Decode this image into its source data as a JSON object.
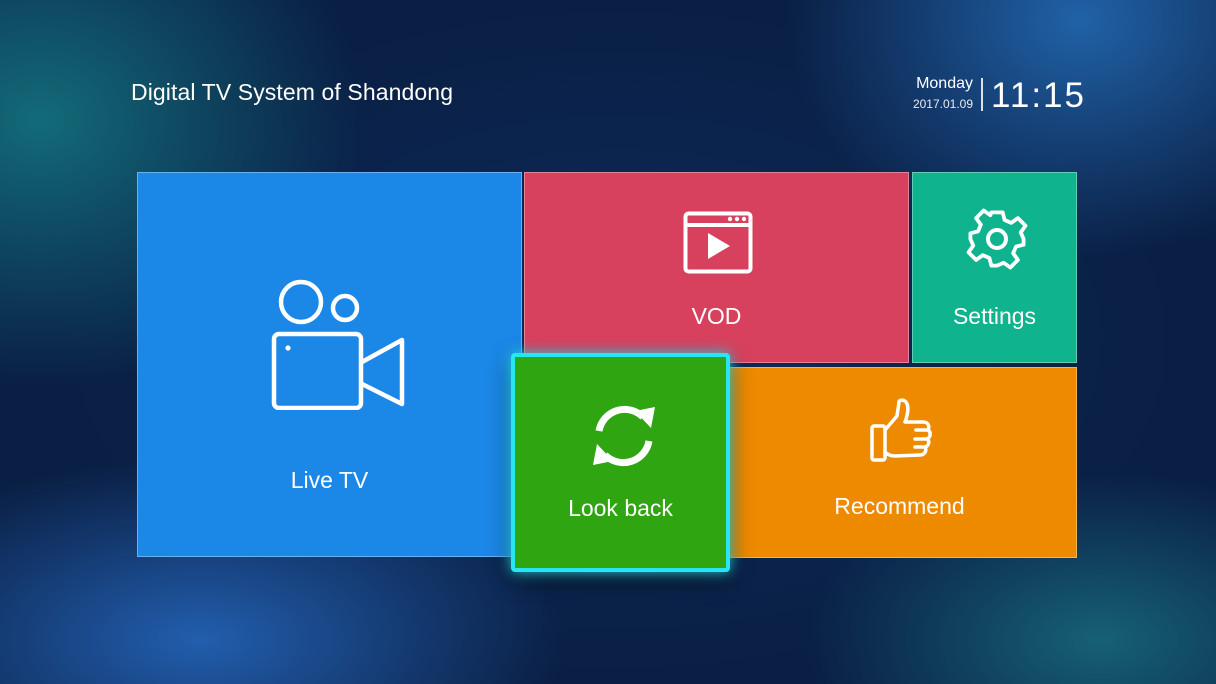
{
  "header": {
    "title": "Digital TV System of Shandong",
    "weekday": "Monday",
    "date": "2017.01.09",
    "time": "11:15"
  },
  "tiles": [
    {
      "id": "live-tv",
      "label": "Live TV",
      "icon": "video-camera-icon",
      "color": "#1b87e6"
    },
    {
      "id": "vod",
      "label": "VOD",
      "icon": "video-play-icon",
      "color": "#d8415e"
    },
    {
      "id": "settings",
      "label": "Settings",
      "icon": "gear-icon",
      "color": "#0fb38e"
    },
    {
      "id": "look-back",
      "label": "Look back",
      "icon": "refresh-icon",
      "color": "#2fa512",
      "focused": true,
      "focus_color": "#27e6f2"
    },
    {
      "id": "recommend",
      "label": "Recommend",
      "icon": "thumbs-up-icon",
      "color": "#ee8a00"
    }
  ]
}
